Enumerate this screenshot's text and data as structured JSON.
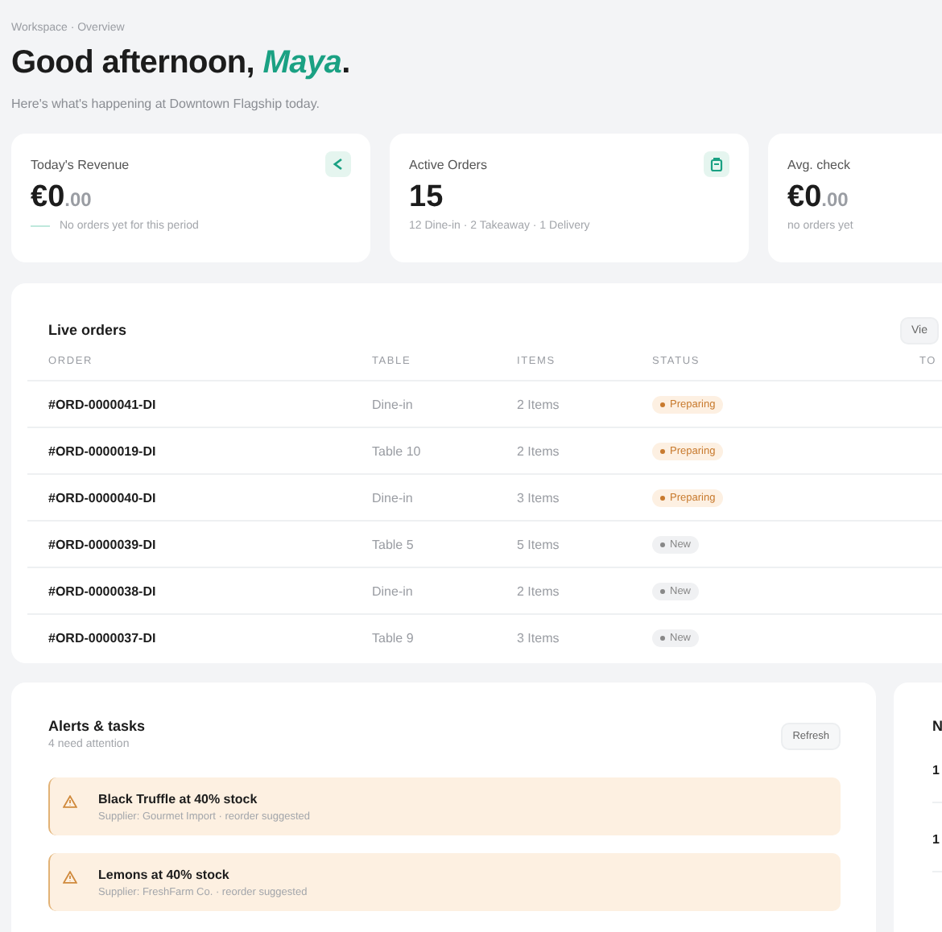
{
  "breadcrumb": "Workspace · Overview",
  "greeting": {
    "text": "Good afternoon, ",
    "name": "Maya",
    "end": "."
  },
  "subtitle": "Here's what's happening at Downtown Flagship today.",
  "stats": [
    {
      "label": "Today's Revenue",
      "value": "€0",
      "cents": ".00",
      "note": "No orders yet for this period",
      "kind": "revenue",
      "trend": true
    },
    {
      "label": "Active Orders",
      "value": "15",
      "note": "12 Dine-in · 2 Takeaway · 1 Delivery",
      "kind": "orders",
      "trend": false
    },
    {
      "label": "Avg. check",
      "value": "€0",
      "cents": ".00",
      "note": "no orders yet",
      "kind": "average",
      "trend": false
    }
  ],
  "live_orders": {
    "title": "Live orders",
    "button": "Vie",
    "columns": [
      "ORDER",
      "TABLE",
      "ITEMS",
      "STATUS",
      "TO"
    ],
    "rows": [
      {
        "order": "#ORD-0000041-DI",
        "table": "Dine-in",
        "items": "2 Items",
        "status": "Preparing",
        "kind": "preparing"
      },
      {
        "order": "#ORD-0000019-DI",
        "table": "Table 10",
        "items": "2 Items",
        "status": "Preparing",
        "kind": "preparing"
      },
      {
        "order": "#ORD-0000040-DI",
        "table": "Dine-in",
        "items": "3 Items",
        "status": "Preparing",
        "kind": "preparing"
      },
      {
        "order": "#ORD-0000039-DI",
        "table": "Table 5",
        "items": "5 Items",
        "status": "New",
        "kind": "new"
      },
      {
        "order": "#ORD-0000038-DI",
        "table": "Dine-in",
        "items": "2 Items",
        "status": "New",
        "kind": "new"
      },
      {
        "order": "#ORD-0000037-DI",
        "table": "Table 9",
        "items": "3 Items",
        "status": "New",
        "kind": "new"
      }
    ]
  },
  "alerts": {
    "title": "Alerts & tasks",
    "subtitle": "4 need attention",
    "button": "Refresh",
    "items": [
      {
        "title": "Black Truffle at 40% stock",
        "detail": "Supplier: Gourmet Import · reorder suggested"
      },
      {
        "title": "Lemons at 40% stock",
        "detail": "Supplier: FreshFarm Co. · reorder suggested"
      }
    ]
  },
  "side_panel": {
    "title": "N",
    "rows": [
      "1",
      "1"
    ]
  }
}
